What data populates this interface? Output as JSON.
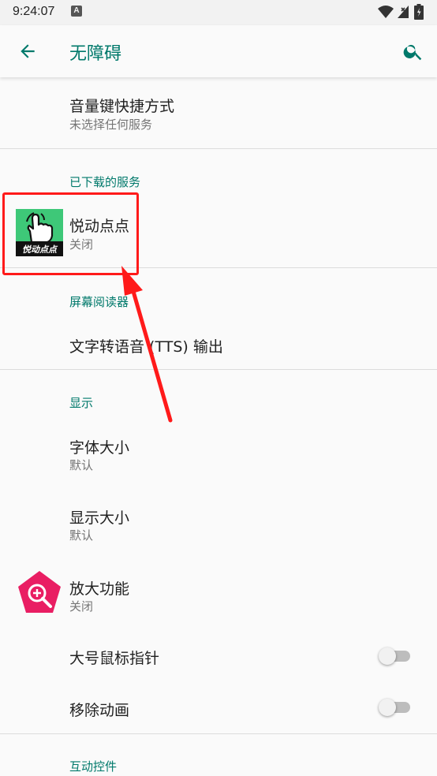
{
  "status_bar": {
    "time": "9:24:07",
    "notification_badge": "A"
  },
  "toolbar": {
    "title": "无障碍",
    "back_icon": "arrow-back-icon",
    "search_icon": "search-icon"
  },
  "shortcut": {
    "title": "音量键快捷方式",
    "summary": "未选择任何服务"
  },
  "downloaded": {
    "header": "已下载的服务",
    "item": {
      "title": "悦动点点",
      "summary": "关闭",
      "icon_text": "悦动点点"
    }
  },
  "screen_reader": {
    "header": "屏幕阅读器",
    "tts": {
      "title": "文字转语音 (TTS) 输出"
    }
  },
  "display": {
    "header": "显示",
    "font_size": {
      "title": "字体大小",
      "summary": "默认"
    },
    "display_size": {
      "title": "显示大小",
      "summary": "默认"
    },
    "magnification": {
      "title": "放大功能",
      "summary": "关闭"
    },
    "large_pointer": {
      "title": "大号鼠标指针",
      "checked": false
    },
    "remove_animations": {
      "title": "移除动画",
      "checked": false
    }
  },
  "interaction": {
    "header": "互动控件"
  },
  "colors": {
    "accent": "#00796b",
    "highlight": "#ff1a1a",
    "magnify_icon": "#e91e63"
  }
}
